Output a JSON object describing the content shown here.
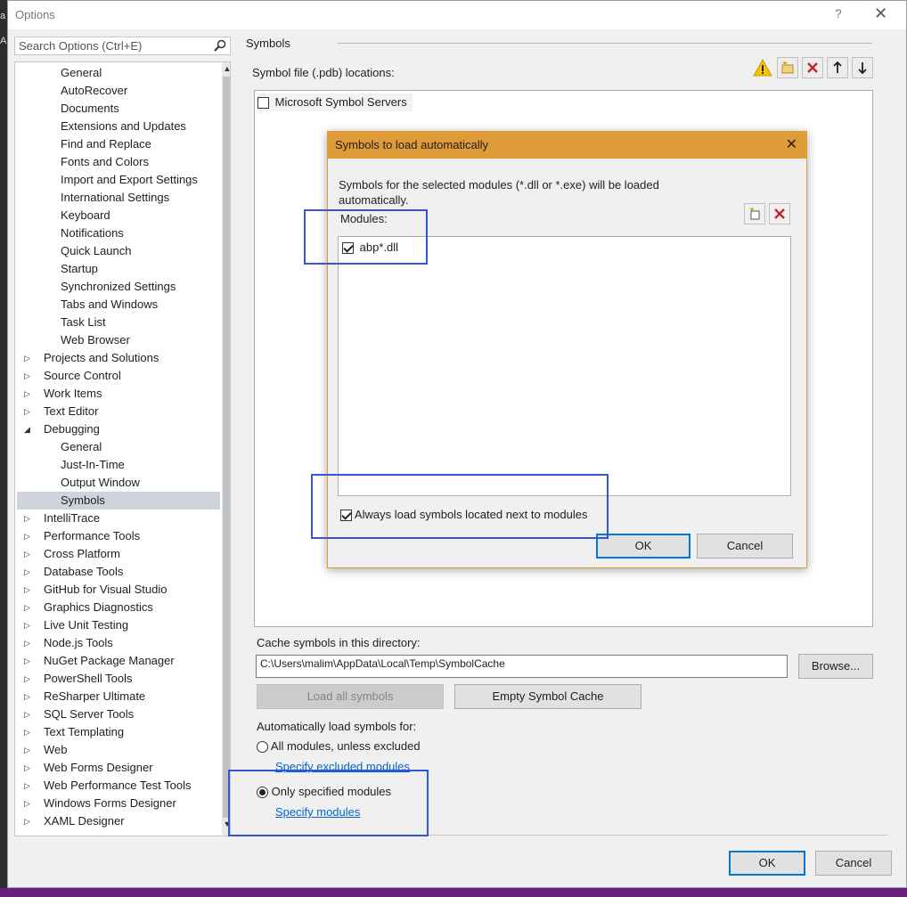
{
  "window": {
    "title": "Options",
    "help": "?",
    "close": "✕"
  },
  "search": {
    "placeholder": "Search Options (Ctrl+E)"
  },
  "tree": {
    "items": [
      {
        "label": "General",
        "level": 1
      },
      {
        "label": "AutoRecover",
        "level": 1
      },
      {
        "label": "Documents",
        "level": 1
      },
      {
        "label": "Extensions and Updates",
        "level": 1
      },
      {
        "label": "Find and Replace",
        "level": 1
      },
      {
        "label": "Fonts and Colors",
        "level": 1
      },
      {
        "label": "Import and Export Settings",
        "level": 1
      },
      {
        "label": "International Settings",
        "level": 1
      },
      {
        "label": "Keyboard",
        "level": 1
      },
      {
        "label": "Notifications",
        "level": 1
      },
      {
        "label": "Quick Launch",
        "level": 1
      },
      {
        "label": "Startup",
        "level": 1
      },
      {
        "label": "Synchronized Settings",
        "level": 1
      },
      {
        "label": "Tabs and Windows",
        "level": 1
      },
      {
        "label": "Task List",
        "level": 1
      },
      {
        "label": "Web Browser",
        "level": 1
      },
      {
        "label": "Projects and Solutions",
        "level": 0,
        "expander": "▷"
      },
      {
        "label": "Source Control",
        "level": 0,
        "expander": "▷"
      },
      {
        "label": "Work Items",
        "level": 0,
        "expander": "▷"
      },
      {
        "label": "Text Editor",
        "level": 0,
        "expander": "▷"
      },
      {
        "label": "Debugging",
        "level": 0,
        "expander": "◢"
      },
      {
        "label": "General",
        "level": 1
      },
      {
        "label": "Just-In-Time",
        "level": 1
      },
      {
        "label": "Output Window",
        "level": 1
      },
      {
        "label": "Symbols",
        "level": 1,
        "selected": true
      },
      {
        "label": "IntelliTrace",
        "level": 0,
        "expander": "▷"
      },
      {
        "label": "Performance Tools",
        "level": 0,
        "expander": "▷"
      },
      {
        "label": "Cross Platform",
        "level": 0,
        "expander": "▷"
      },
      {
        "label": "Database Tools",
        "level": 0,
        "expander": "▷"
      },
      {
        "label": "GitHub for Visual Studio",
        "level": 0,
        "expander": "▷"
      },
      {
        "label": "Graphics Diagnostics",
        "level": 0,
        "expander": "▷"
      },
      {
        "label": "Live Unit Testing",
        "level": 0,
        "expander": "▷"
      },
      {
        "label": "Node.js Tools",
        "level": 0,
        "expander": "▷"
      },
      {
        "label": "NuGet Package Manager",
        "level": 0,
        "expander": "▷"
      },
      {
        "label": "PowerShell Tools",
        "level": 0,
        "expander": "▷"
      },
      {
        "label": "ReSharper Ultimate",
        "level": 0,
        "expander": "▷"
      },
      {
        "label": "SQL Server Tools",
        "level": 0,
        "expander": "▷"
      },
      {
        "label": "Text Templating",
        "level": 0,
        "expander": "▷"
      },
      {
        "label": "Web",
        "level": 0,
        "expander": "▷"
      },
      {
        "label": "Web Forms Designer",
        "level": 0,
        "expander": "▷"
      },
      {
        "label": "Web Performance Test Tools",
        "level": 0,
        "expander": "▷"
      },
      {
        "label": "Windows Forms Designer",
        "level": 0,
        "expander": "▷"
      },
      {
        "label": "XAML Designer",
        "level": 0,
        "expander": "▷"
      }
    ],
    "scroll_up": "▲",
    "scroll_down": "▼"
  },
  "symbols": {
    "section_title": "Symbols",
    "locations_label": "Symbol file (.pdb) locations:",
    "locations": [
      {
        "label": "Microsoft Symbol Servers",
        "checked": false
      }
    ],
    "cache_label": "Cache symbols in this directory:",
    "cache_path": "C:\\Users\\malim\\AppData\\Local\\Temp\\SymbolCache",
    "browse_label": "Browse...",
    "load_all_label": "Load all symbols",
    "empty_cache_label": "Empty Symbol Cache",
    "auto_load_label": "Automatically load symbols for:",
    "radio_all_label": "All modules, unless excluded",
    "radio_all_checked": false,
    "specify_excluded_link": "Specify excluded modules",
    "radio_only_label": "Only specified modules",
    "radio_only_checked": true,
    "specify_modules_link": "Specify modules"
  },
  "dialog": {
    "title": "Symbols to load automatically",
    "close": "✕",
    "description": "Symbols for the selected modules (*.dll or *.exe) will be loaded automatically.",
    "modules_label": "Modules:",
    "modules": [
      {
        "label": "abp*.dll",
        "checked": true
      }
    ],
    "always_load_label": "Always load symbols located next to modules",
    "always_load_checked": true,
    "ok_label": "OK",
    "cancel_label": "Cancel"
  },
  "footer": {
    "ok_label": "OK",
    "cancel_label": "Cancel"
  },
  "colors": {
    "dialog_title_bg": "#e09b39",
    "highlight": "#3555d6",
    "link": "#0066cc",
    "accent": "#0078d7",
    "warning": "#f5c400",
    "delete_red": "#c1272d"
  },
  "background_fragments": [
    "a",
    "A"
  ]
}
